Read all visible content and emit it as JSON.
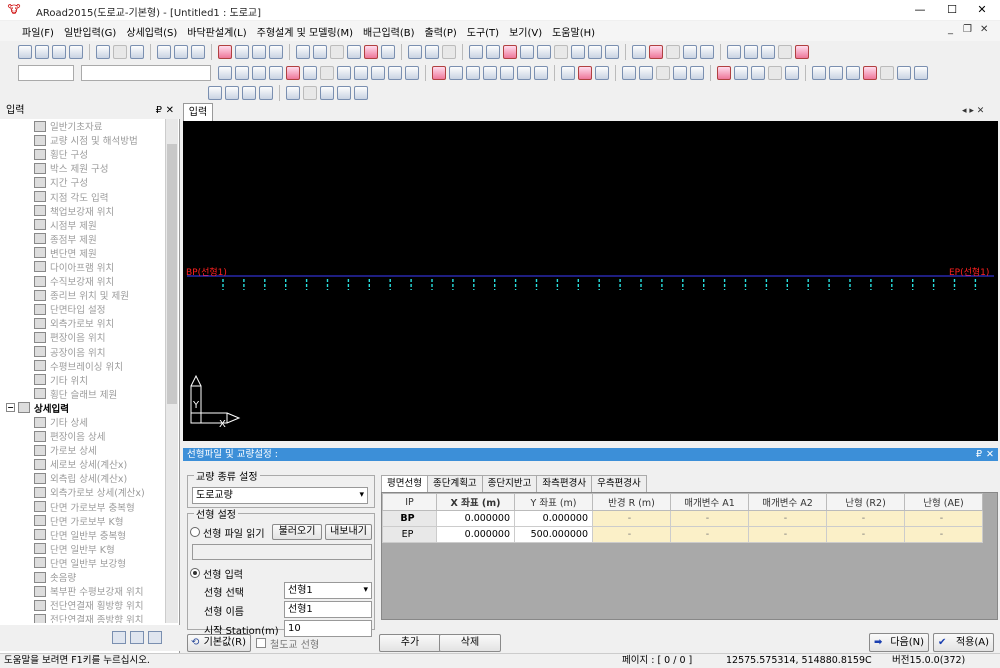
{
  "title": "ARoad2015(도로교-기본형) - [Untitled1 : 도로교]",
  "window_controls": {
    "minimize": "—",
    "maximize": "☐",
    "close": "✕",
    "mdi_min": "_",
    "mdi_restore": "❐",
    "mdi_close": "✕"
  },
  "menu": [
    "파일(F)",
    "일반입력(G)",
    "상세입력(S)",
    "바닥판설계(L)",
    "주형설계 및 모델링(M)",
    "배근입력(B)",
    "출력(P)",
    "도구(T)",
    "보기(V)",
    "도움말(H)"
  ],
  "left_panel": {
    "title": "입력",
    "pin": "₽",
    "close": "✕",
    "group_label": "상세입력",
    "items_top": [
      "일반기초자료",
      "교량 시점 및 해석방법",
      "횡단 구성",
      "박스 제원 구성",
      "지간 구성",
      "지점 각도 입력",
      "책업보강재 위치",
      "시점부 제원",
      "종점부 제원",
      "변단면 제원",
      "다이아프램 위치",
      "수직보강재 위치",
      "종리브 위치 및 제원",
      "단면타입 설정",
      "외측가로보 위치",
      "편장이음 위치",
      "공장이음 위치",
      "수평브레이싱 위치",
      "기타 위치",
      "횡단 슬래브 제원"
    ],
    "items_bottom": [
      "기타 상세",
      "편장이음 상세",
      "가로보 상세",
      "세로보 상세(계산x)",
      "외측립 상세(계산x)",
      "외측가로보 상세(계산x)",
      "단면 가로보부 충복형",
      "단면 가로보부 K형",
      "단면 일반부 충복형",
      "단면 일반부 K형",
      "단면 일반부 보강형",
      "솟음량",
      "복부판 수평보강재 위치",
      "전단연결재 횡방향 위치",
      "전단연결재 종방향 위치"
    ]
  },
  "canvas": {
    "tab": "입력",
    "nav": "◂ ▸ ✕",
    "bp_label": "BP(선형1)",
    "ep_label": "EP(선형1)",
    "axis_y": "Y",
    "axis_x": "X"
  },
  "dialog": {
    "title": "선형파일 및 교량설정 :",
    "pin": "₽",
    "close": "✕",
    "bridge_type_legend": "교량 종류 설정",
    "bridge_type": "도로교량",
    "alignment_legend": "선형 설정",
    "file_read_label": "선형 파일 읽기",
    "load_button": "불러오기",
    "export_button": "내보내기",
    "file_path": "",
    "input_label": "선형 입력",
    "select_label": "선형 선택",
    "select_value": "선형1",
    "name_label": "선형 이름",
    "name_value": "선형1",
    "station_label": "시작 Station(m)",
    "station_value": "10",
    "tabs": [
      "평면선형",
      "종단계획고",
      "종단지반고",
      "좌측편경사",
      "우측편경사"
    ],
    "columns": [
      "IP",
      "X 좌표 (m)",
      "Y 좌표 (m)",
      "반경 R (m)",
      "매개변수 A1",
      "매개변수 A2",
      "난형 (R2)",
      "난형 (AE)"
    ],
    "rows": [
      [
        "BP",
        "0.000000",
        "0.000000",
        "-",
        "-",
        "-",
        "-",
        "-"
      ],
      [
        "EP",
        "0.000000",
        "500.000000",
        "-",
        "-",
        "-",
        "-",
        "-"
      ]
    ],
    "default_button": "기본값(R)",
    "railway_checkbox": "철도교 선형",
    "add_button": "추가",
    "delete_button": "삭제",
    "next_button": "다음(N)",
    "apply_button": "적용(A)"
  },
  "status": {
    "help": "도움말을 보려면 F1키를 누르십시오.",
    "page": "페이지 : [ 0 / 0 ]",
    "coords": "12575.575314,  514880.8159C",
    "version": "버전15.0.0(372)"
  }
}
